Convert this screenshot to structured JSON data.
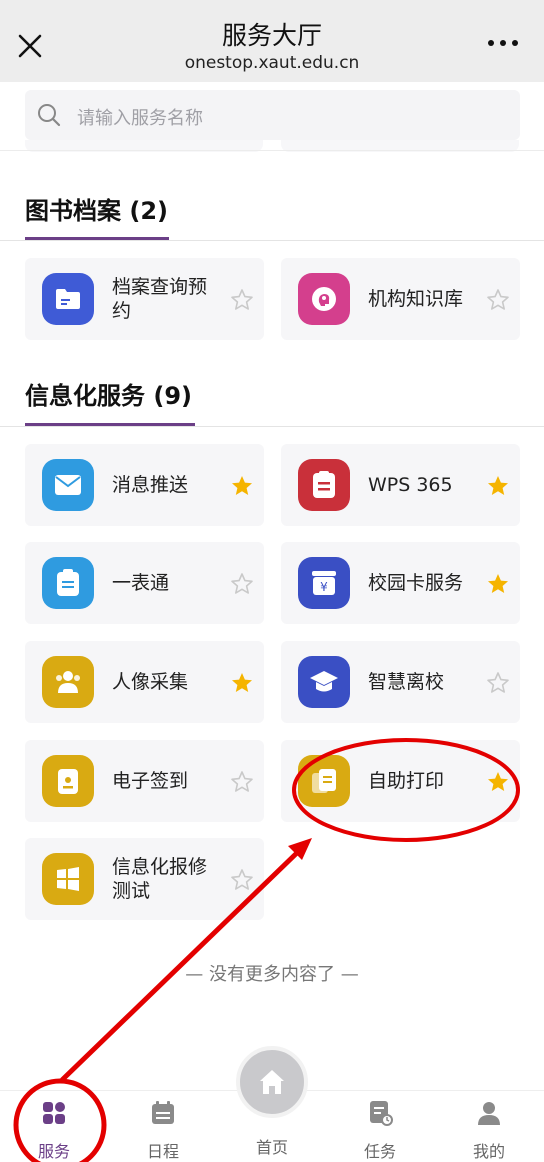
{
  "header": {
    "title": "服务大厅",
    "subtitle": "onestop.xaut.edu.cn"
  },
  "search": {
    "placeholder": "请输入服务名称"
  },
  "sections": [
    {
      "title": "图书档案 (2)",
      "items": [
        {
          "label": "档案查询预约",
          "icon": "folder-icon",
          "color": "#3f5bd6",
          "starred": false
        },
        {
          "label": "机构知识库",
          "icon": "brain-icon",
          "color": "#d43f8d",
          "starred": false
        }
      ]
    },
    {
      "title": "信息化服务 (9)",
      "items": [
        {
          "label": "消息推送",
          "icon": "mail-icon",
          "color": "#2f9be0",
          "starred": true
        },
        {
          "label": "WPS 365",
          "icon": "document-icon",
          "color": "#c9303a",
          "starred": true
        },
        {
          "label": "一表通",
          "icon": "clipboard-icon",
          "color": "#2f9be0",
          "starred": false
        },
        {
          "label": "校园卡服务",
          "icon": "card-icon",
          "color": "#3a4fc4",
          "starred": true
        },
        {
          "label": "人像采集",
          "icon": "people-icon",
          "color": "#d9aa12",
          "starred": true
        },
        {
          "label": "智慧离校",
          "icon": "graduation-cap-icon",
          "color": "#3a4fc4",
          "starred": false
        },
        {
          "label": "电子签到",
          "icon": "badge-icon",
          "color": "#d9aa12",
          "starred": false
        },
        {
          "label": "自助打印",
          "icon": "print-icon",
          "color": "#d9aa12",
          "starred": true
        },
        {
          "label": "信息化报修测试",
          "icon": "windows-icon",
          "color": "#d9aa12",
          "starred": false
        }
      ]
    }
  ],
  "end_text": "— 没有更多内容了 —",
  "tabs": [
    {
      "label": "服务",
      "icon": "grid-icon",
      "active": true
    },
    {
      "label": "日程",
      "icon": "calendar-icon",
      "active": false
    },
    {
      "label": "首页",
      "icon": "home-icon",
      "active": false
    },
    {
      "label": "任务",
      "icon": "task-icon",
      "active": false
    },
    {
      "label": "我的",
      "icon": "user-icon",
      "active": false
    }
  ],
  "colors": {
    "accent": "#6b3f87",
    "star_on": "#f5b400",
    "star_off": "#c9c9c9",
    "annotation": "#e30000"
  }
}
